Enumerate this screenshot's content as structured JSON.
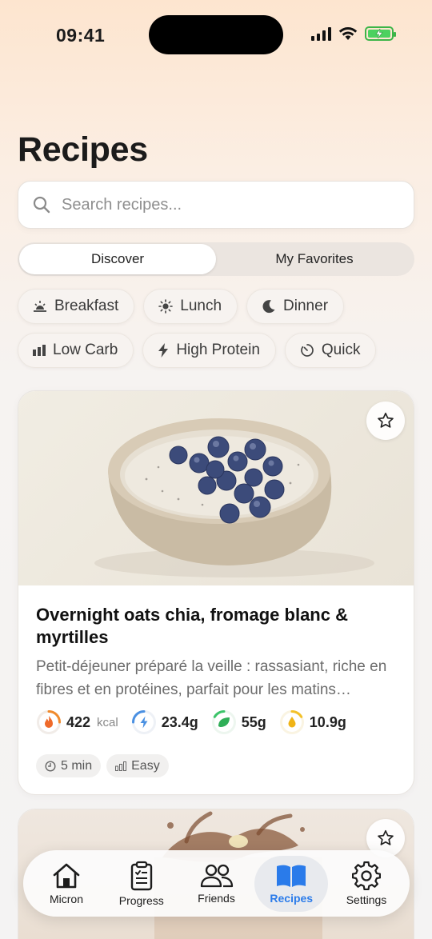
{
  "status_bar": {
    "time": "09:41"
  },
  "header": {
    "title": "Recipes"
  },
  "search": {
    "placeholder": "Search recipes..."
  },
  "segments": [
    {
      "label": "Discover",
      "active": true
    },
    {
      "label": "My Favorites",
      "active": false
    }
  ],
  "chips": [
    {
      "label": "Breakfast",
      "icon": "sunrise-icon"
    },
    {
      "label": "Lunch",
      "icon": "sun-icon"
    },
    {
      "label": "Dinner",
      "icon": "moon-icon"
    },
    {
      "label": "Low Carb",
      "icon": "bars-icon"
    },
    {
      "label": "High Protein",
      "icon": "bolt-icon"
    },
    {
      "label": "Quick",
      "icon": "timer-icon"
    }
  ],
  "recipes": [
    {
      "title": "Overnight oats chia, fromage blanc & myrtilles",
      "description": "Petit-déjeuner préparé la veille : rassasiant, riche en fibres et en protéines, parfait pour les matins…",
      "nutrition": [
        {
          "value": "422",
          "unit": "kcal",
          "icon": "flame-icon",
          "color": "#f08a2c"
        },
        {
          "value": "23.4g",
          "unit": "",
          "icon": "bolt-icon",
          "color": "#4a90e2"
        },
        {
          "value": "55g",
          "unit": "",
          "icon": "leaf-icon",
          "color": "#3cc46a"
        },
        {
          "value": "10.9g",
          "unit": "",
          "icon": "drop-icon",
          "color": "#f3c12a"
        }
      ],
      "tags": [
        {
          "label": "5 min",
          "icon": "clock-icon"
        },
        {
          "label": "Easy",
          "icon": "difficulty-icon"
        }
      ]
    }
  ],
  "tabbar": [
    {
      "label": "Micron",
      "icon": "home-icon",
      "active": false
    },
    {
      "label": "Progress",
      "icon": "clipboard-icon",
      "active": false
    },
    {
      "label": "Friends",
      "icon": "people-icon",
      "active": false
    },
    {
      "label": "Recipes",
      "icon": "book-icon",
      "active": true
    },
    {
      "label": "Settings",
      "icon": "gear-icon",
      "active": false
    }
  ],
  "colors": {
    "accent": "#2a7bea",
    "battery": "#4cd160"
  }
}
